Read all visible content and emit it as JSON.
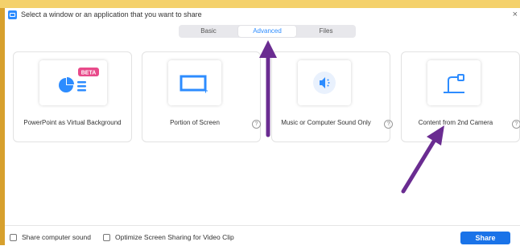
{
  "window": {
    "title": "Select a window or an application that you want to share",
    "close_glyph": "×"
  },
  "tabs": [
    {
      "label": "Basic",
      "active": false
    },
    {
      "label": "Advanced",
      "active": true
    },
    {
      "label": "Files",
      "active": false
    }
  ],
  "cards": [
    {
      "label": "PowerPoint as Virtual Background",
      "icon": "powerpoint-icon",
      "badge": "BETA",
      "help": ""
    },
    {
      "label": "Portion of Screen",
      "icon": "screen-portion-icon",
      "help": "?"
    },
    {
      "label": "Music or Computer Sound Only",
      "icon": "speaker-icon",
      "help": "?"
    },
    {
      "label": "Content from 2nd Camera",
      "icon": "camera-icon",
      "help": "?"
    }
  ],
  "footer": {
    "share_sound_label": "Share computer sound",
    "optimize_label": "Optimize Screen Sharing for Video Clip",
    "share_button_label": "Share"
  },
  "colors": {
    "accent": "#2d8cff",
    "share_button": "#1a73e8",
    "annotation_arrow": "#6a2c91",
    "beta_badge": "#e84a8a"
  }
}
